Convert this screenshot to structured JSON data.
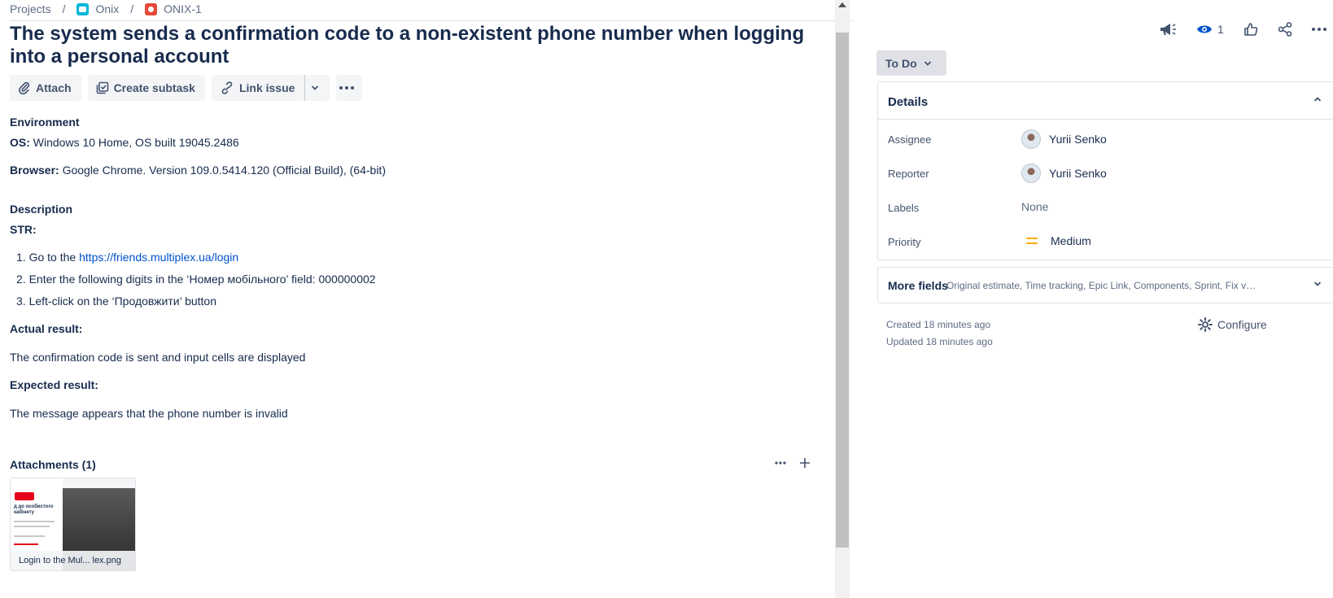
{
  "breadcrumb": {
    "projects": "Projects",
    "project": "Onix",
    "issue_key": "ONIX-1",
    "separator": "/"
  },
  "issue": {
    "title": "The system sends a confirmation code to a non-existent phone number when logging into a personal account"
  },
  "toolbar": {
    "attach": "Attach",
    "create_subtask": "Create subtask",
    "link_issue": "Link issue"
  },
  "environment": {
    "heading": "Environment",
    "os_label": "OS:",
    "os_value": " Windows 10 Home, OS built 19045.2486",
    "browser_label": "Browser:",
    "browser_value": " Google Chrome. Version 109.0.5414.120 (Official Build), (64-bit)"
  },
  "description": {
    "heading": "Description",
    "str_label": "STR:",
    "steps": [
      {
        "prefix": "1. Go to the ",
        "link": "https://friends.multiplex.ua/login"
      },
      {
        "text": "2. Enter the following digits in the ‘Номер мобільного’ field: 000000002"
      },
      {
        "text": "3. Left-click on the ‘Продовжити’ button"
      }
    ],
    "actual_label": "Actual result:",
    "actual_text": "The confirmation code is sent and input cells are displayed",
    "expected_label": "Expected result:",
    "expected_text": "The message appears that the phone number is invalid"
  },
  "attachments": {
    "heading": "Attachments (1)",
    "files": [
      {
        "caption": "Login to the Mul... lex.png"
      }
    ]
  },
  "thumbnail_text": {
    "title": "д до особистого кабінету"
  },
  "top_actions": {
    "watch_count": "1"
  },
  "status": {
    "label": "To Do"
  },
  "details": {
    "heading": "Details",
    "assignee_label": "Assignee",
    "assignee": "Yurii Senko",
    "reporter_label": "Reporter",
    "reporter": "Yurii Senko",
    "labels_label": "Labels",
    "labels": "None",
    "priority_label": "Priority",
    "priority": "Medium"
  },
  "more_fields": {
    "label": "More fields",
    "list": "Original estimate, Time tracking, Epic Link, Components, Sprint, Fix ver..."
  },
  "meta": {
    "created": "Created 18 minutes ago",
    "updated": "Updated 18 minutes ago",
    "configure": "Configure"
  },
  "colors": {
    "link": "#0052cc",
    "text": "#172b4d",
    "priority_medium": "#ffab00",
    "bug": "#e5493a",
    "project": "#00b8d9"
  },
  "icons": [
    "attach-icon",
    "subtask-icon",
    "link-icon",
    "chevron-down-icon",
    "more-icon",
    "announce-icon",
    "eye-icon",
    "thumbs-up-icon",
    "share-icon",
    "gear-icon",
    "plus-icon"
  ]
}
